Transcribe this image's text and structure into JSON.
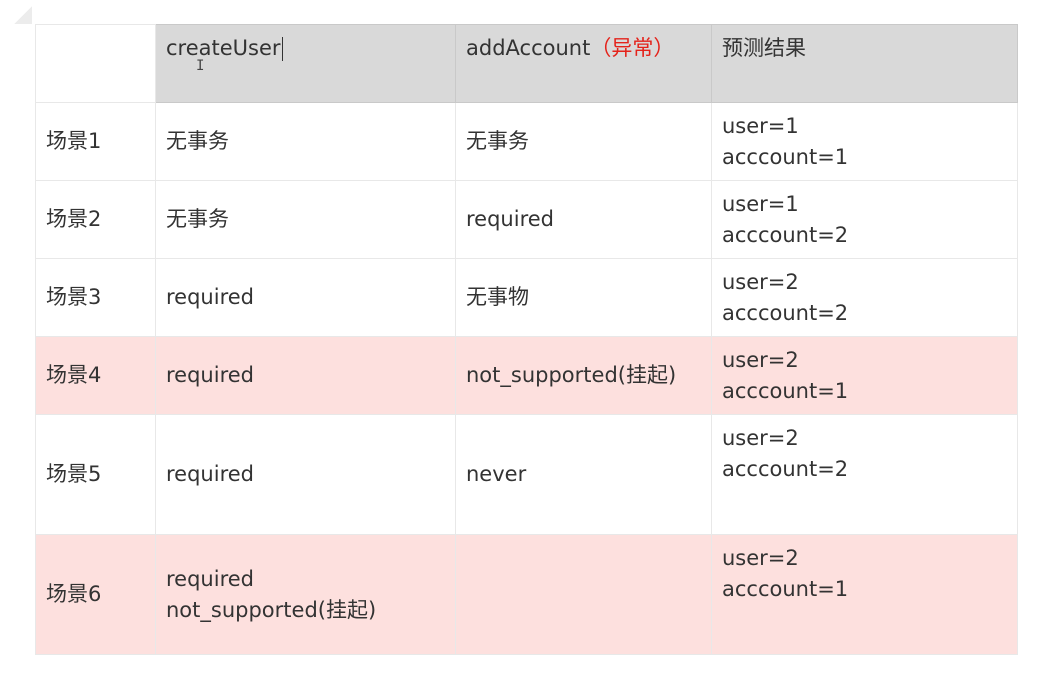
{
  "table": {
    "headers": {
      "col1": "createUser",
      "col2": "addAccount",
      "col2_note": "（异常）",
      "col3": "预测结果"
    },
    "rows": [
      {
        "scene": "场景1",
        "create_user": "无事务",
        "create_user_2": "",
        "add_account": "无事务",
        "user": "user=1",
        "account": "acccount=1"
      },
      {
        "scene": "场景2",
        "create_user": "无事务",
        "create_user_2": "",
        "add_account": "required",
        "user": "user=1",
        "account": "acccount=2"
      },
      {
        "scene": "场景3",
        "create_user": "required",
        "create_user_2": "",
        "add_account": "无事物",
        "user": "user=2",
        "account": "acccount=2"
      },
      {
        "scene": "场景4",
        "create_user": "required",
        "create_user_2": "",
        "add_account": "not_supported(挂起)",
        "user": "user=2",
        "account": "acccount=1"
      },
      {
        "scene": "场景5",
        "create_user": "required",
        "create_user_2": "",
        "add_account": "never",
        "user": "user=2",
        "account": "acccount=2"
      },
      {
        "scene": "场景6",
        "create_user": "required",
        "create_user_2": "not_supported(挂起)",
        "add_account": "",
        "user": "user=2",
        "account": "acccount=1"
      }
    ],
    "highlight_color": "#fde0de",
    "header_color": "#d9d9d9",
    "warning_color": "#e4231b"
  }
}
